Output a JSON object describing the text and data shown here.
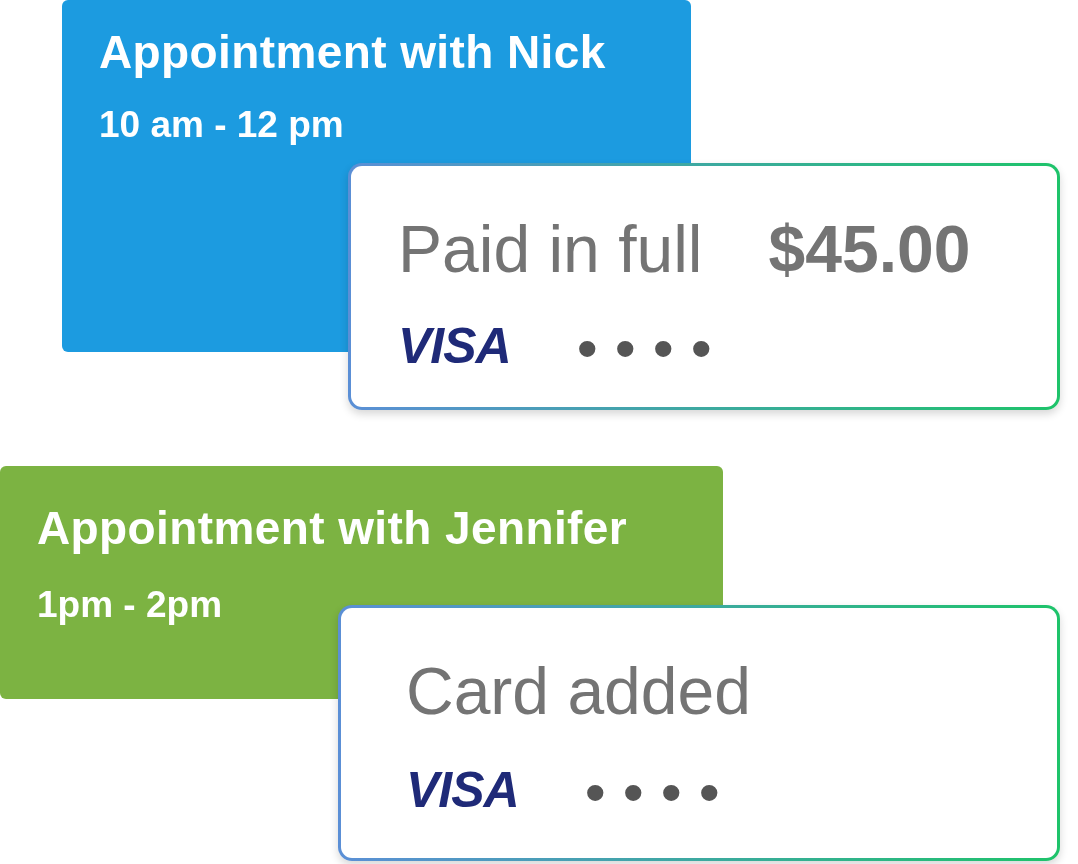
{
  "appointments": [
    {
      "title": "Appointment with Nick",
      "time": "10 am - 12 pm",
      "color": "#1c9be0",
      "payment": {
        "status": "Paid in full",
        "amount": "$45.00",
        "card_brand": "VISA",
        "card_mask": "••••"
      }
    },
    {
      "title": "Appointment with Jennifer",
      "time": "1pm - 2pm",
      "color": "#7cb342",
      "payment": {
        "status": "Card added",
        "card_brand": "VISA",
        "card_mask": "••••"
      }
    }
  ]
}
